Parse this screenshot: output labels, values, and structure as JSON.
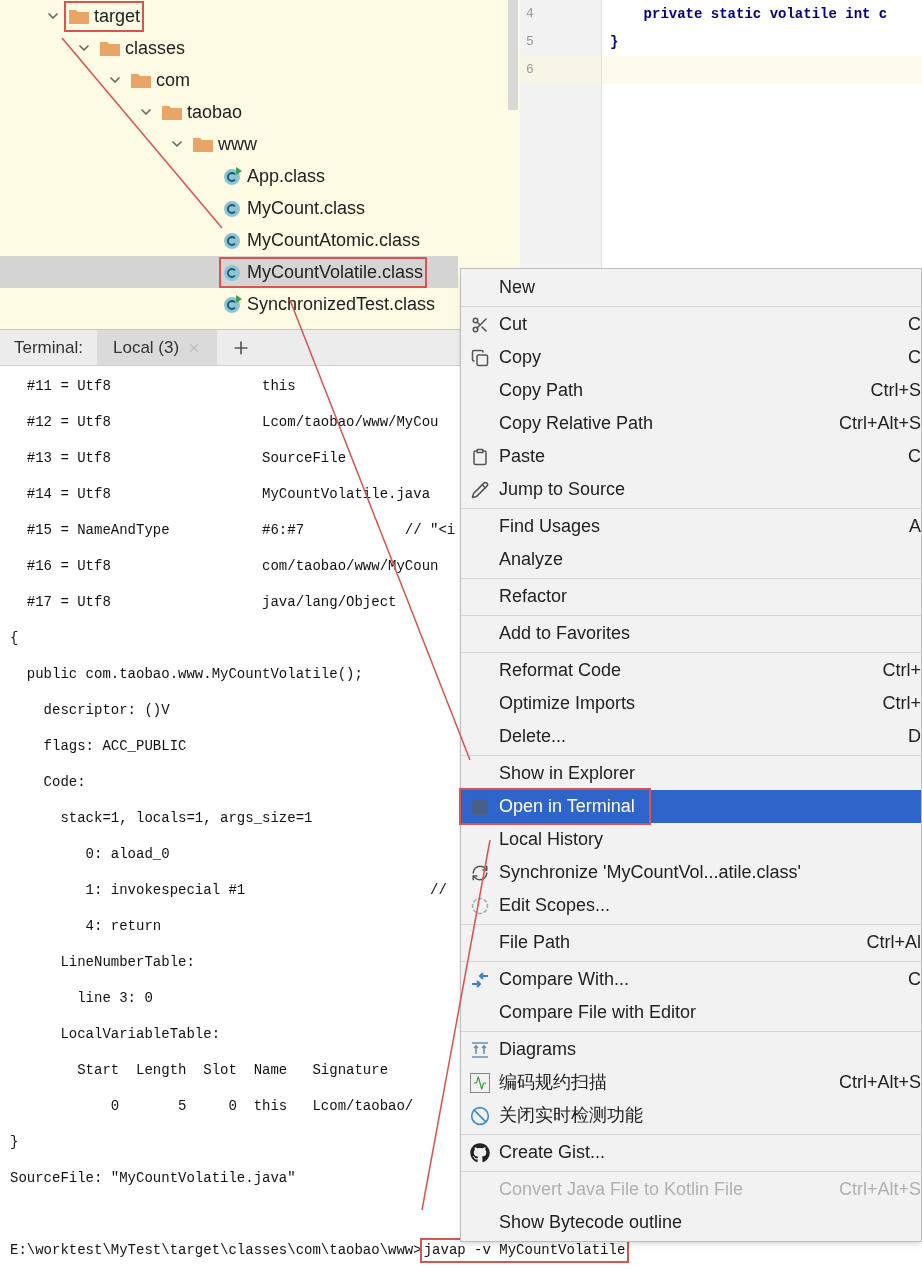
{
  "project_tree": {
    "items": [
      {
        "label": "target",
        "kind": "folder",
        "expanded": true,
        "selected": false,
        "boxed": true,
        "children": [
          {
            "label": "classes",
            "kind": "folder",
            "expanded": true,
            "selected": false,
            "boxed": false,
            "children": [
              {
                "label": "com",
                "kind": "folder",
                "expanded": true,
                "selected": false,
                "boxed": false,
                "children": [
                  {
                    "label": "taobao",
                    "kind": "folder",
                    "expanded": true,
                    "selected": false,
                    "boxed": false,
                    "children": [
                      {
                        "label": "www",
                        "kind": "folder",
                        "expanded": true,
                        "selected": false,
                        "boxed": false,
                        "children": [
                          {
                            "label": "App.class",
                            "kind": "runnable",
                            "selected": false,
                            "boxed": false
                          },
                          {
                            "label": "MyCount.class",
                            "kind": "class",
                            "selected": false,
                            "boxed": false
                          },
                          {
                            "label": "MyCountAtomic.class",
                            "kind": "class",
                            "selected": false,
                            "boxed": false
                          },
                          {
                            "label": "MyCountVolatile.class",
                            "kind": "class",
                            "selected": true,
                            "boxed": true
                          },
                          {
                            "label": "SynchronizedTest.class",
                            "kind": "runnable",
                            "selected": false,
                            "boxed": false
                          }
                        ]
                      }
                    ]
                  }
                ]
              }
            ]
          }
        ]
      }
    ]
  },
  "editor": {
    "lines": [
      {
        "number": "4",
        "code": "    private static volatile int c",
        "current": false
      },
      {
        "number": "5",
        "code": "}",
        "current": false
      },
      {
        "number": "6",
        "current": true
      }
    ]
  },
  "terminal": {
    "title": "Terminal:",
    "tabs": [
      {
        "label": "Local (3)",
        "selected": true
      }
    ],
    "lines": [
      "  #11 = Utf8                  this",
      "  #12 = Utf8                  Lcom/taobao/www/MyCou",
      "  #13 = Utf8                  SourceFile",
      "  #14 = Utf8                  MyCountVolatile.java",
      "  #15 = NameAndType           #6:#7            // \"<i",
      "  #16 = Utf8                  com/taobao/www/MyCoun",
      "  #17 = Utf8                  java/lang/Object",
      "{",
      "  public com.taobao.www.MyCountVolatile();",
      "    descriptor: ()V",
      "    flags: ACC_PUBLIC",
      "    Code:",
      "      stack=1, locals=1, args_size=1",
      "         0: aload_0",
      "         1: invokespecial #1                      //",
      "         4: return",
      "      LineNumberTable:",
      "        line 3: 0",
      "      LocalVariableTable:",
      "        Start  Length  Slot  Name   Signature",
      "            0       5     0  this   Lcom/taobao/",
      "}",
      "SourceFile: \"MyCountVolatile.java\""
    ],
    "prompt": "E:\\worktest\\MyTest\\target\\classes\\com\\taobao\\www>",
    "command": {
      "text": "javap -v MyCountVolatile",
      "boxed": true
    }
  },
  "context_menu": {
    "groups": [
      [
        {
          "label": "New",
          "selected": false,
          "disabled": false,
          "boxed": false
        }
      ],
      [
        {
          "label": "Cut",
          "kind": "scissors",
          "shortcut": "C",
          "selected": false,
          "disabled": false,
          "boxed": false
        },
        {
          "label": "Copy",
          "kind": "copy",
          "shortcut": "C",
          "selected": false,
          "disabled": false,
          "boxed": false
        },
        {
          "label": "Copy Path",
          "shortcut": "Ctrl+S",
          "selected": false,
          "disabled": false,
          "boxed": false
        },
        {
          "label": "Copy Relative Path",
          "shortcut": "Ctrl+Alt+S",
          "selected": false,
          "disabled": false,
          "boxed": false
        },
        {
          "label": "Paste",
          "kind": "clipboard",
          "shortcut": "C",
          "selected": false,
          "disabled": false,
          "boxed": false
        },
        {
          "label": "Jump to Source",
          "kind": "pencil",
          "selected": false,
          "disabled": false,
          "boxed": false
        }
      ],
      [
        {
          "label": "Find Usages",
          "shortcut": "A",
          "selected": false,
          "disabled": false,
          "boxed": false
        },
        {
          "label": "Analyze",
          "selected": false,
          "disabled": false,
          "boxed": false
        }
      ],
      [
        {
          "label": "Refactor",
          "selected": false,
          "disabled": false,
          "boxed": false
        }
      ],
      [
        {
          "label": "Add to Favorites",
          "selected": false,
          "disabled": false,
          "boxed": false
        }
      ],
      [
        {
          "label": "Reformat Code",
          "shortcut": "Ctrl+",
          "selected": false,
          "disabled": false,
          "boxed": false
        },
        {
          "label": "Optimize Imports",
          "shortcut": "Ctrl+",
          "selected": false,
          "disabled": false,
          "boxed": false
        },
        {
          "label": "Delete...",
          "shortcut": "D",
          "selected": false,
          "disabled": false,
          "boxed": false
        }
      ],
      [
        {
          "label": "Show in Explorer",
          "selected": false,
          "disabled": false,
          "boxed": false
        },
        {
          "label": "Open in Terminal",
          "kind": "terminal",
          "selected": true,
          "disabled": false,
          "boxed": true
        },
        {
          "label": "Local History",
          "selected": false,
          "disabled": false,
          "boxed": false
        },
        {
          "label": "Synchronize 'MyCountVol...atile.class'",
          "kind": "sync",
          "selected": false,
          "disabled": false,
          "boxed": false
        },
        {
          "label": "Edit Scopes...",
          "kind": "scope",
          "selected": false,
          "disabled": false,
          "boxed": false
        }
      ],
      [
        {
          "label": "File Path",
          "shortcut": "Ctrl+Al",
          "selected": false,
          "disabled": false,
          "boxed": false
        }
      ],
      [
        {
          "label": "Compare With...",
          "kind": "compare",
          "shortcut": "C",
          "selected": false,
          "disabled": false,
          "boxed": false
        },
        {
          "label": "Compare File with Editor",
          "selected": false,
          "disabled": false,
          "boxed": false
        }
      ],
      [
        {
          "label": "Diagrams",
          "kind": "diagram",
          "selected": false,
          "disabled": false,
          "boxed": false
        },
        {
          "label": "编码规约扫描",
          "kind": "scan",
          "shortcut": "Ctrl+Alt+S",
          "selected": false,
          "disabled": false,
          "boxed": false
        },
        {
          "label": "关闭实时检测功能",
          "kind": "ban",
          "selected": false,
          "disabled": false,
          "boxed": false
        }
      ],
      [
        {
          "label": "Create Gist...",
          "kind": "github",
          "selected": false,
          "disabled": false,
          "boxed": false
        }
      ],
      [
        {
          "label": "Convert Java File to Kotlin File",
          "shortcut": "Ctrl+Alt+S",
          "selected": false,
          "disabled": true,
          "boxed": false
        },
        {
          "label": "Show Bytecode outline",
          "selected": false,
          "disabled": false,
          "boxed": false
        }
      ]
    ]
  }
}
